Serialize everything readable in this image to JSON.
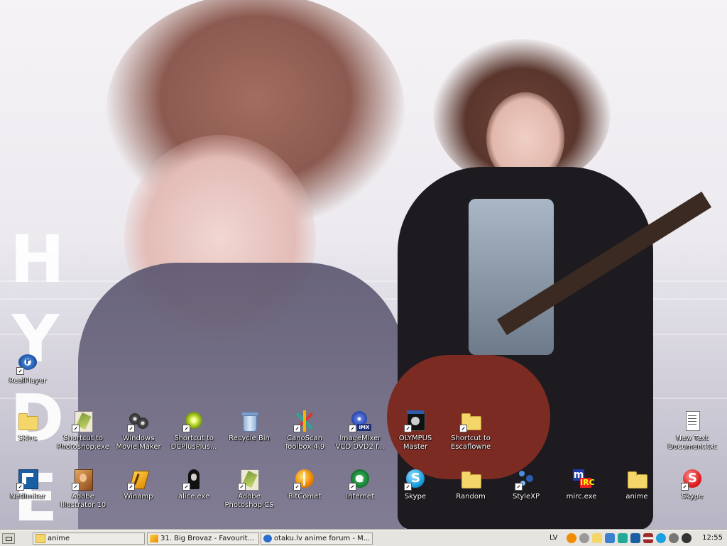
{
  "wallpaper": {
    "letters": [
      "H",
      "Y",
      "D",
      "E"
    ]
  },
  "desktop": {
    "icons": [
      {
        "id": "realplayer",
        "label": "RealPlayer",
        "icon": "realplayer-icon"
      },
      {
        "id": "skins",
        "label": "Skins",
        "icon": "folder-icon"
      },
      {
        "id": "photoshop-shortcut",
        "label": "Shortcut to\nPhotoshop.exe",
        "icon": "photoshop-icon"
      },
      {
        "id": "movie-maker",
        "label": "Windows\nMovie Maker",
        "icon": "movie-maker-icon"
      },
      {
        "id": "dcplusplus",
        "label": "Shortcut to\nDCPlusPlus...",
        "icon": "dcplusplus-icon"
      },
      {
        "id": "recycle-bin",
        "label": "Recycle Bin",
        "icon": "recycle-bin-icon"
      },
      {
        "id": "canoscan",
        "label": "CanoScan\nToolbox 4.9",
        "icon": "canoscan-icon"
      },
      {
        "id": "imagemixer",
        "label": "ImageMixer\nVCD DVD2 f...",
        "icon": "imagemixer-icon"
      },
      {
        "id": "olympus",
        "label": "OLYMPUS\nMaster",
        "icon": "olympus-icon"
      },
      {
        "id": "escaflowne",
        "label": "Shortcut to\nEscaflowne",
        "icon": "folder-icon"
      },
      {
        "id": "new-text",
        "label": "New Text\nDocument.txt",
        "icon": "text-document-icon"
      },
      {
        "id": "netlimiter",
        "label": "Netlimiter",
        "icon": "netlimiter-icon"
      },
      {
        "id": "illustrator",
        "label": "Adobe\nIllustrator 10",
        "icon": "illustrator-icon"
      },
      {
        "id": "winamp",
        "label": "Winamp",
        "icon": "winamp-icon"
      },
      {
        "id": "alice",
        "label": "alice.exe",
        "icon": "alice-icon"
      },
      {
        "id": "photoshop-cs",
        "label": "Adobe\nPhotoshop CS",
        "icon": "photoshop-icon"
      },
      {
        "id": "bitcomet",
        "label": "BitComet",
        "icon": "bitcomet-icon"
      },
      {
        "id": "internet",
        "label": "Internet",
        "icon": "internet-explorer-icon"
      },
      {
        "id": "skype1",
        "label": "Skype",
        "icon": "skype-icon"
      },
      {
        "id": "random",
        "label": "Random",
        "icon": "folder-icon"
      },
      {
        "id": "stylexp",
        "label": "StyleXP",
        "icon": "stylexp-icon"
      },
      {
        "id": "mirc",
        "label": "mirc.exe",
        "icon": "mirc-icon"
      },
      {
        "id": "anime",
        "label": "anime",
        "icon": "folder-icon"
      },
      {
        "id": "skype2",
        "label": "Skype",
        "icon": "skype-icon"
      }
    ]
  },
  "taskbar": {
    "tasks": [
      {
        "label": "anime",
        "icon": "folder-icon"
      },
      {
        "label": "31. Big Brovaz - Favourit...",
        "icon": "winamp-icon"
      },
      {
        "label": "otaku.lv anime forum - M...",
        "icon": "internet-explorer-icon"
      }
    ],
    "tray_lang": "LV",
    "clock": "12:55"
  }
}
